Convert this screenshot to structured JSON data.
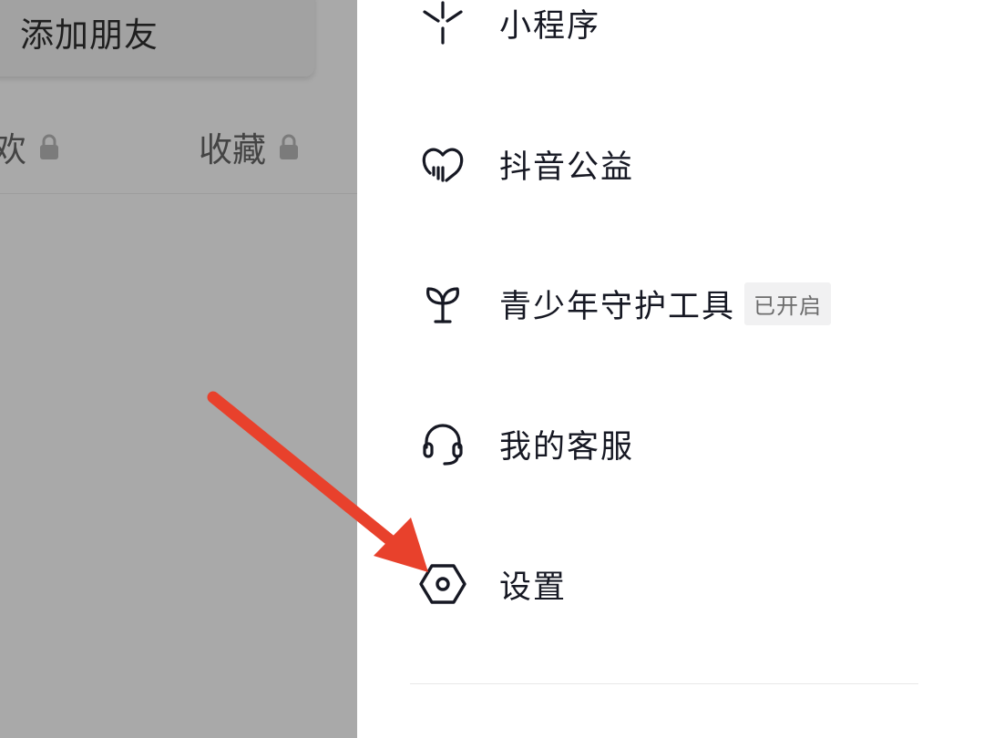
{
  "background_page": {
    "add_friend_label": "添加朋友",
    "tabs": [
      {
        "label": "欢",
        "icon": "lock-icon"
      },
      {
        "label": "收藏",
        "icon": "lock-icon"
      }
    ]
  },
  "menu": {
    "items": [
      {
        "label": "小程序",
        "icon": "mini-program-icon"
      },
      {
        "label": "抖音公益",
        "icon": "charity-heart-icon"
      },
      {
        "label": "青少年守护工具",
        "icon": "sprout-icon",
        "badge": "已开启"
      },
      {
        "label": "我的客服",
        "icon": "headset-icon"
      },
      {
        "label": "设置",
        "icon": "hexagon-settings-icon"
      }
    ]
  },
  "annotation": {
    "arrow_color": "#e8412c",
    "points_to": "settings"
  }
}
